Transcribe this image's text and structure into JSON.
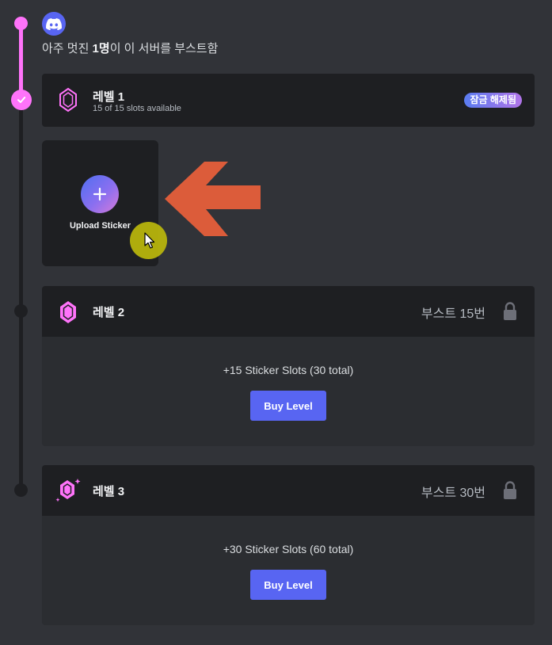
{
  "header": {
    "icon": "discord-icon",
    "boost_prefix": "아주 멋진 ",
    "boost_count": "1명",
    "boost_suffix": "이 이 서버를 부스트함"
  },
  "colors": {
    "background": "#313338",
    "card_header": "#1e1f22",
    "card_body": "#2b2d31",
    "timeline_active": "#ff73fa",
    "timeline_inactive": "#1e1f22",
    "button": "#5865f2",
    "highlight_arrow": "#dc5c3a",
    "cursor_highlight": "#b7b40d"
  },
  "levels": [
    {
      "title": "레벨 1",
      "subtitle": "15 of 15 slots available",
      "status_badge": "잠금 해제됨",
      "icon": "gem-outline-icon"
    },
    {
      "title": "레벨 2",
      "boost_requirement": "부스트 15번",
      "slots_text": "+15 Sticker Slots (30 total)",
      "button_label": "Buy Level",
      "icon": "gem-icon",
      "lock_icon": "lock-icon"
    },
    {
      "title": "레벨 3",
      "boost_requirement": "부스트 30번",
      "slots_text": "+30 Sticker Slots (60 total)",
      "button_label": "Buy Level",
      "icon": "gem-sparkle-icon",
      "lock_icon": "lock-icon"
    }
  ],
  "upload_tile": {
    "label": "Upload Sticker",
    "icon": "plus-icon"
  },
  "annotations": {
    "arrow": "left-arrow-icon",
    "cursor": "mouse-pointer-icon"
  }
}
